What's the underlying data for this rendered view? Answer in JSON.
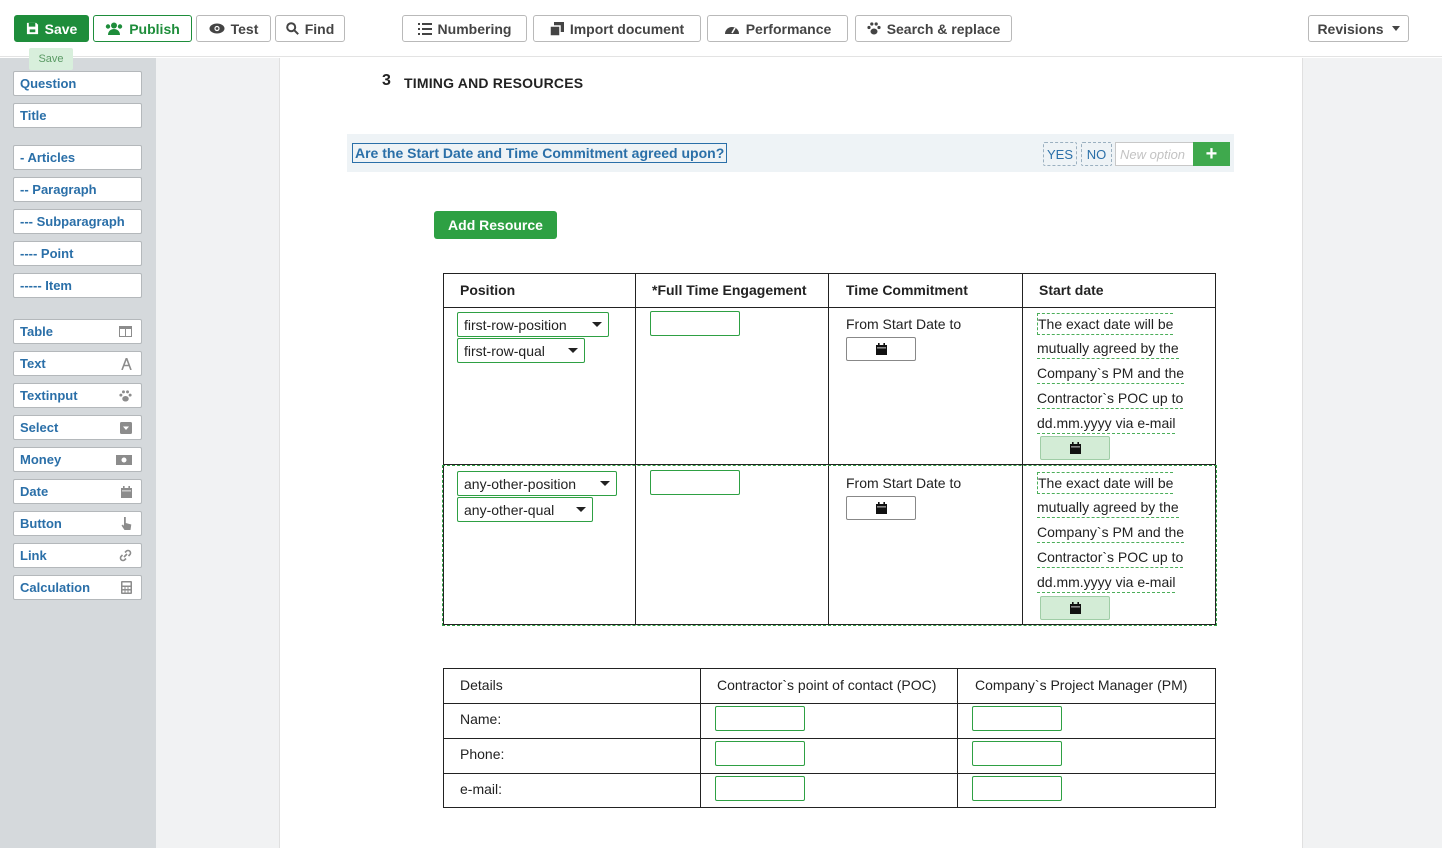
{
  "toolbar": {
    "save": "Save",
    "publish": "Publish",
    "test": "Test",
    "find": "Find",
    "numbering": "Numbering",
    "import": "Import document",
    "performance": "Performance",
    "search_replace": "Search & replace",
    "revisions": "Revisions",
    "save_tooltip": "Save"
  },
  "sidebar": {
    "items": [
      {
        "label": "Question",
        "icon": ""
      },
      {
        "label": "Title",
        "icon": ""
      },
      {
        "label": "- Articles",
        "icon": ""
      },
      {
        "label": "-- Paragraph",
        "icon": ""
      },
      {
        "label": "--- Subparagraph",
        "icon": ""
      },
      {
        "label": "---- Point",
        "icon": ""
      },
      {
        "label": "----- Item",
        "icon": ""
      },
      {
        "label": "Table",
        "icon": "table-icon"
      },
      {
        "label": "Text",
        "icon": "text-icon"
      },
      {
        "label": "Textinput",
        "icon": "paw-icon"
      },
      {
        "label": "Select",
        "icon": "select-icon"
      },
      {
        "label": "Money",
        "icon": "money-icon"
      },
      {
        "label": "Date",
        "icon": "calendar-icon"
      },
      {
        "label": "Button",
        "icon": "pointer-icon"
      },
      {
        "label": "Link",
        "icon": "link-icon"
      },
      {
        "label": "Calculation",
        "icon": "calculator-icon"
      }
    ]
  },
  "section": {
    "number": "3",
    "title": "TIMING AND RESOURCES"
  },
  "question": {
    "text": "Are the Start Date and Time Commitment agreed upon?",
    "options": [
      "YES",
      "NO"
    ],
    "new_option_placeholder": "New option"
  },
  "add_resource": "Add Resource",
  "resources": {
    "headers": [
      "Position",
      "*Full Time Engagement",
      "Time Commitment",
      "Start date"
    ],
    "rows": [
      {
        "position": "first-row-position",
        "qual": "first-row-qual",
        "time_commitment": "From Start Date to",
        "start_lines": [
          "The exact date will be",
          "mutually agreed by the",
          "Company`s PM and the",
          "Contractor`s POC up to",
          "dd.mm.yyyy via e-mail"
        ]
      },
      {
        "position": "any-other-position",
        "qual": "any-other-qual",
        "time_commitment": "From Start Date to",
        "start_lines": [
          "The exact date will be",
          "mutually agreed by the",
          "Company`s PM and the",
          "Contractor`s POC up to",
          "dd.mm.yyyy via e-mail"
        ]
      }
    ]
  },
  "details": {
    "headers": [
      "Details",
      "Contractor`s point of contact (POC)",
      "Company`s Project Manager (PM)"
    ],
    "rows": [
      "Name:",
      "Phone:",
      "e-mail:"
    ]
  },
  "colors": {
    "primary_green": "#1e8d3b",
    "link_blue": "#2a6fa8",
    "sidebar_bg": "#d5d9dc"
  }
}
